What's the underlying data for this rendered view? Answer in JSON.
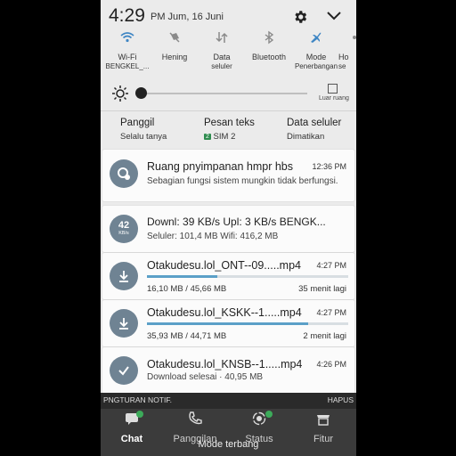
{
  "status": {
    "time": "4:29",
    "pm_date": "PM  Jum, 16 Juni"
  },
  "toggles": [
    {
      "label": "Wi-Fi",
      "sub": "BENGKEL_..."
    },
    {
      "label": "Hening",
      "sub": ""
    },
    {
      "label": "Data",
      "sub": "seluler"
    },
    {
      "label": "Bluetooth",
      "sub": ""
    },
    {
      "label": "Mode",
      "sub": "Penerbangan"
    },
    {
      "label": "Ho",
      "sub": "se"
    }
  ],
  "brightness": {
    "outdoor_label": "Luar ruang",
    "level": 0.0
  },
  "info": {
    "call": {
      "title": "Panggil",
      "value": "Selalu tanya"
    },
    "sms": {
      "title": "Pesan teks",
      "sim_badge": "2",
      "value": "SIM 2"
    },
    "data": {
      "title": "Data seluler",
      "value": "Dimatikan"
    }
  },
  "notifications": [
    {
      "type": "storage",
      "title": "Ruang pnyimpanan hmpr hbs",
      "time": "12:36 PM",
      "text": "Sebagian fungsi sistem mungkin tidak berfungsi."
    },
    {
      "type": "speed",
      "icon_value": "42",
      "icon_unit": "KB/s",
      "title": "Downl: 39 KB/s   Upl: 3 KB/s   BENGK...",
      "text": "Seluler: 101,4 MB   Wifi: 416,2 MB"
    },
    {
      "type": "download",
      "title": "Otakudesu.lol_ONT--09.....mp4",
      "time": "4:27 PM",
      "size": "16,10 MB / 45,66 MB",
      "remaining": "35 menit lagi",
      "progress": 0.35
    },
    {
      "type": "download",
      "title": "Otakudesu.lol_KSKK--1.....mp4",
      "time": "4:27 PM",
      "size": "35,93 MB / 44,71 MB",
      "remaining": "2 menit lagi",
      "progress": 0.8
    },
    {
      "type": "done",
      "title": "Otakudesu.lol_KNSB--1.....mp4",
      "time": "4:26 PM",
      "text": "Download selesai · 40,95 MB"
    }
  ],
  "bottom": {
    "notif_settings": "PNGTURAN NOTIF.",
    "clear": "HAPUS",
    "tabs": [
      "Chat",
      "Panggilan",
      "Status",
      "Fitur"
    ],
    "airplane_mode": "Mode terbang"
  },
  "colors": {
    "accent": "#5ba0c8",
    "toggle_active": "#3f86c4",
    "icon_bg": "#6f8393",
    "sim_green": "#2f8c4f"
  }
}
